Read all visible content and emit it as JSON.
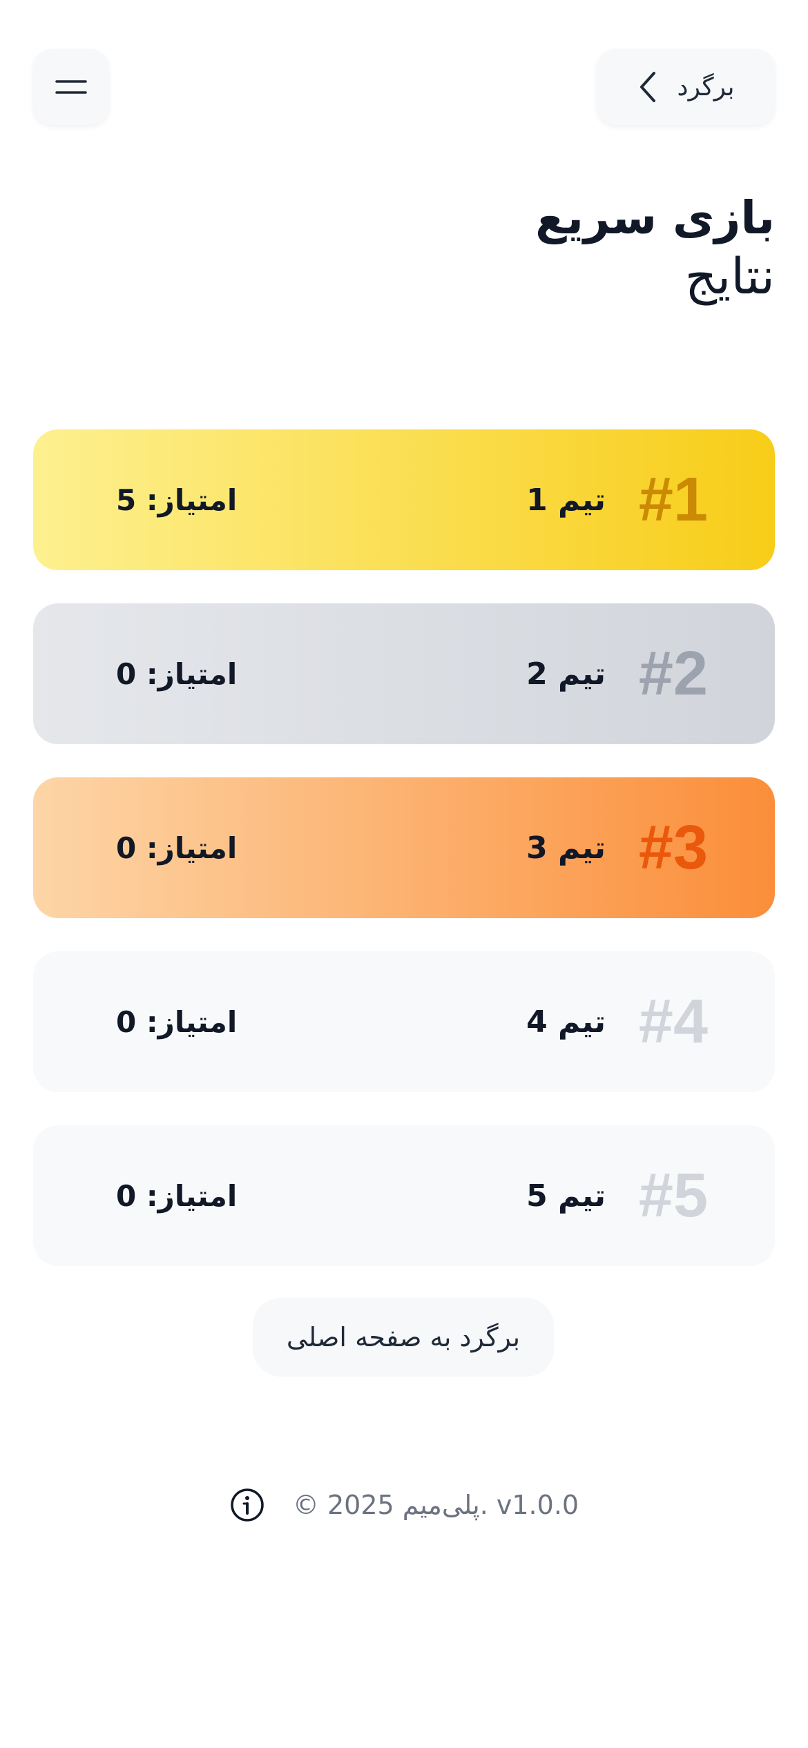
{
  "header": {
    "back_label": "برگرد",
    "back_icon": "chevron-left-icon",
    "menu_icon": "menu-icon"
  },
  "title": {
    "main": "بازی سریع",
    "sub": "نتایج"
  },
  "results": [
    {
      "rank": "#1",
      "team": "تیم 1",
      "score": "امتیاز: 5",
      "bg_from": "#fdf08f",
      "bg_to": "#f8cd18",
      "rank_color": "#ca8a04"
    },
    {
      "rank": "#2",
      "team": "تیم 2",
      "score": "امتیاز: 0",
      "bg_from": "#e5e7eb",
      "bg_to": "#d1d5db",
      "rank_color": "#9ca3af"
    },
    {
      "rank": "#3",
      "team": "تیم 3",
      "score": "امتیاز: 0",
      "bg_from": "#fdd5a6",
      "bg_to": "#fb8e3a",
      "rank_color": "#ea580c"
    },
    {
      "rank": "#4",
      "team": "تیم 4",
      "score": "امتیاز: 0",
      "bg_from": "#f8f9fb",
      "bg_to": "#f8f9fb",
      "rank_color": "#d1d5db"
    },
    {
      "rank": "#5",
      "team": "تیم 5",
      "score": "امتیاز: 0",
      "bg_from": "#f8f9fb",
      "bg_to": "#f8f9fb",
      "rank_color": "#d1d5db"
    }
  ],
  "home_button": {
    "label": "برگرد به صفحه اصلی"
  },
  "footer": {
    "text": "© 2025 پلی‌میم. v1.0.0",
    "info_icon": "info-icon"
  }
}
